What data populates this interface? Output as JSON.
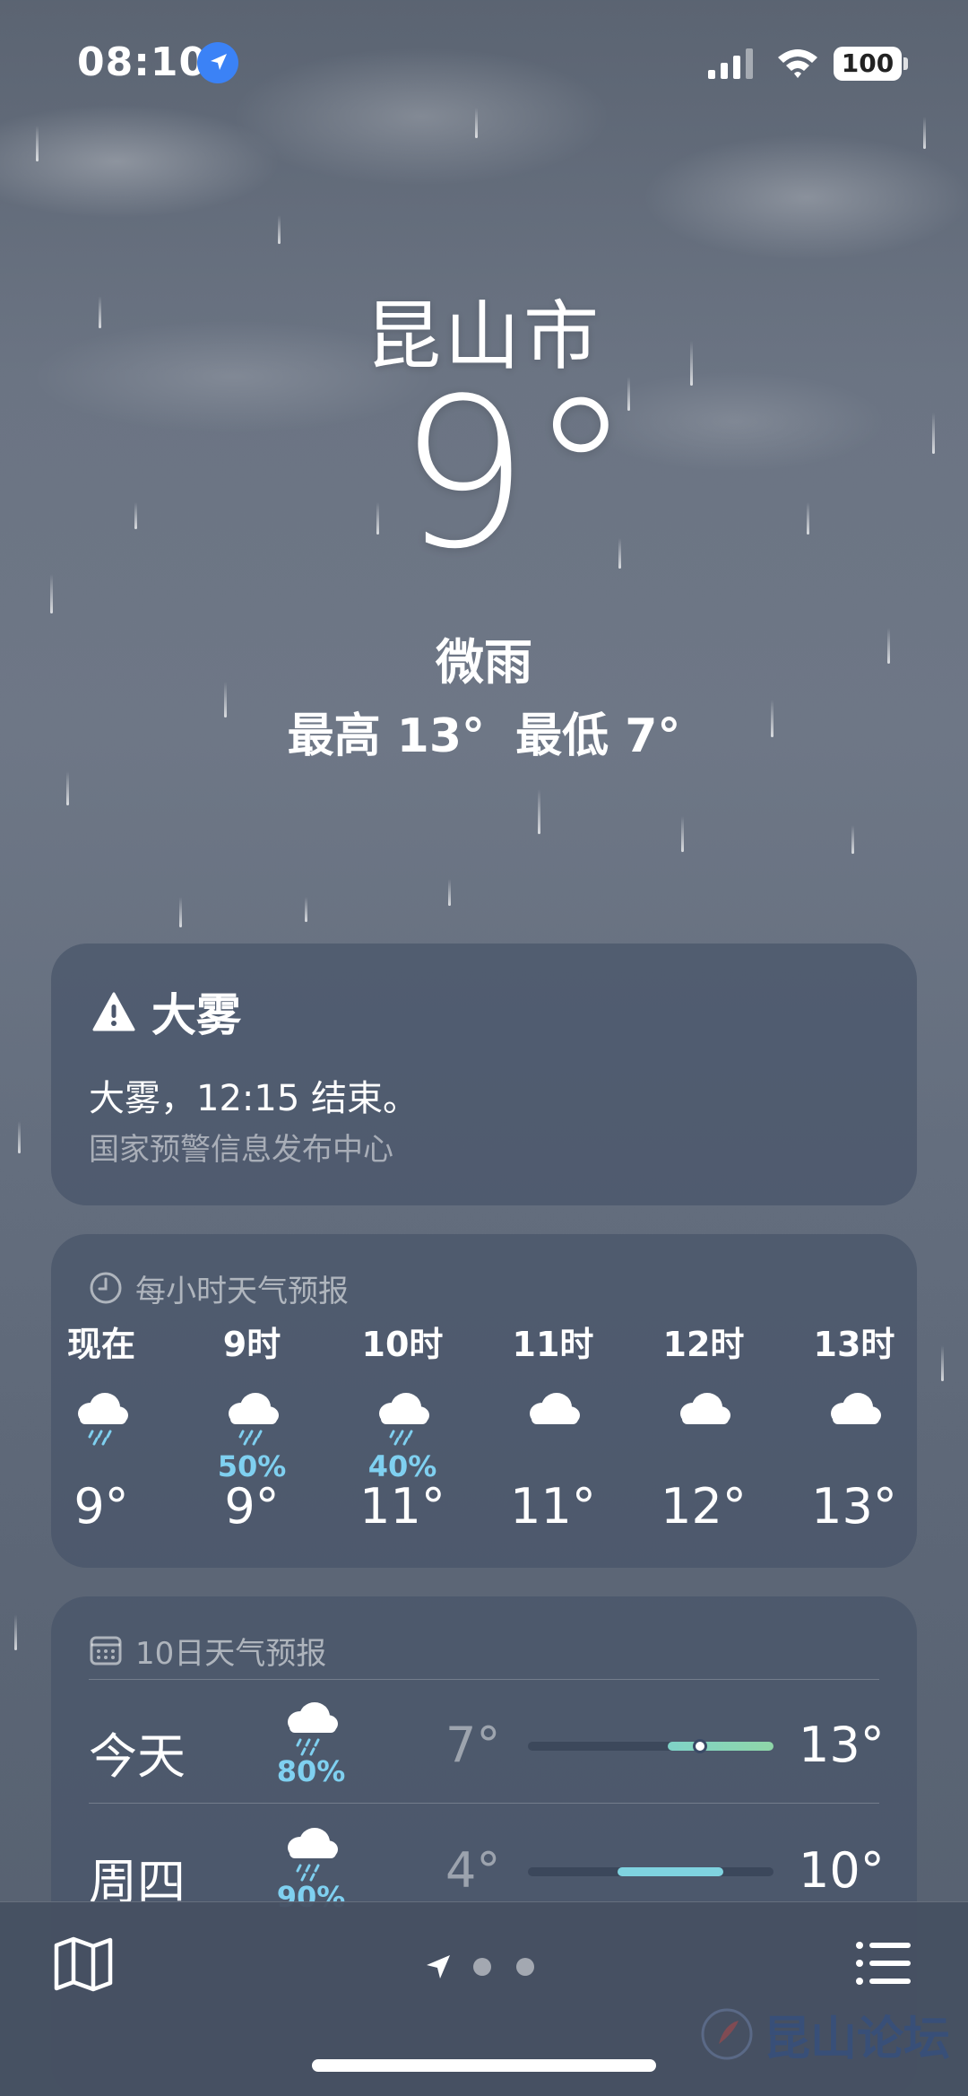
{
  "status_bar": {
    "time": "08:10",
    "battery": "100",
    "icons": [
      "location-arrow-icon",
      "cellular-signal-icon",
      "wifi-icon",
      "battery-icon"
    ]
  },
  "current": {
    "city": "昆山市",
    "temperature": "9°",
    "condition": "微雨",
    "high": "最高 13°",
    "low": "最低 7°"
  },
  "alert": {
    "title": "大雾",
    "text": "大雾，12:15 结束。",
    "source": "国家预警信息发布中心",
    "icon": "warning-triangle-icon"
  },
  "hourly": {
    "header": "每小时天气预报",
    "icon": "clock-icon",
    "items": [
      {
        "label": "现在",
        "icon": "cloud-rain-icon",
        "pop": "",
        "temp": "9°"
      },
      {
        "label": "9时",
        "icon": "cloud-rain-icon",
        "pop": "50%",
        "temp": "9°"
      },
      {
        "label": "10时",
        "icon": "cloud-rain-icon",
        "pop": "40%",
        "temp": "11°"
      },
      {
        "label": "11时",
        "icon": "cloud-icon",
        "pop": "",
        "temp": "11°"
      },
      {
        "label": "12时",
        "icon": "cloud-icon",
        "pop": "",
        "temp": "12°"
      },
      {
        "label": "13时",
        "icon": "cloud-icon",
        "pop": "",
        "temp": "13°"
      }
    ]
  },
  "daily": {
    "header": "10日天气预报",
    "icon": "calendar-icon",
    "items": [
      {
        "day": "今天",
        "icon": "cloud-rain-icon",
        "pop": "80%",
        "low": "7°",
        "high": "13°"
      },
      {
        "day": "周四",
        "icon": "cloud-rain-icon",
        "pop": "90%",
        "low": "4°",
        "high": "10°"
      }
    ]
  },
  "bottom_bar": {
    "icons": [
      "map-icon",
      "location-arrow-icon",
      "page-dot",
      "page-dot",
      "list-icon"
    ]
  },
  "watermark": {
    "text": "昆山论坛"
  },
  "colors": {
    "accent_pop": "#7fd0f0",
    "temp_bar_today": "#8fd6a8",
    "temp_bar_thu": "#7fd3e0",
    "location_badge": "#3b82f6"
  }
}
